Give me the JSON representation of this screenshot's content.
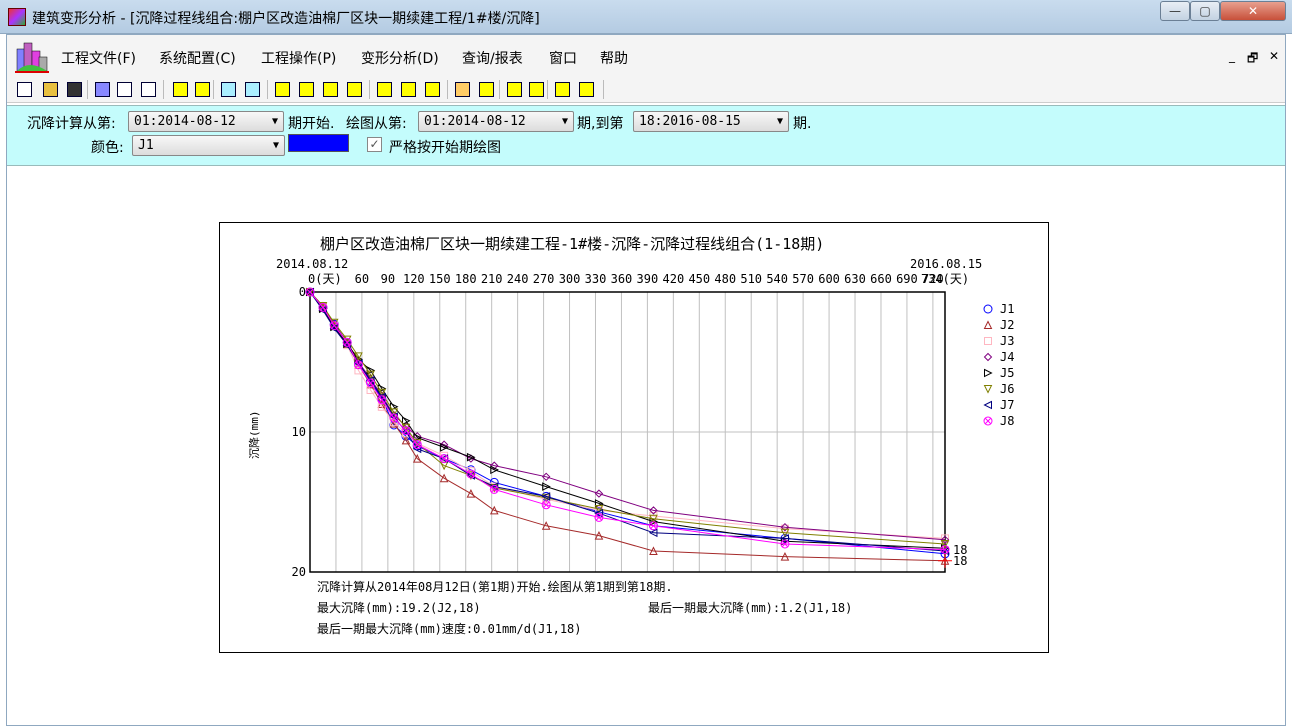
{
  "window": {
    "title": "建筑变形分析 - [沉降过程线组合:棚户区改造油棉厂区块一期续建工程/1#楼/沉降]",
    "controls": {
      "minimize": "—",
      "maximize": "▢",
      "close": "✕"
    }
  },
  "menu": {
    "items": [
      "工程文件(F)",
      "系统配置(C)",
      "工程操作(P)",
      "变形分析(D)",
      "查询/报表",
      "窗口",
      "帮助"
    ],
    "mdi": {
      "minimize": "_",
      "restore": "🗗",
      "close": "✕"
    }
  },
  "params": {
    "calc_from_label": "沉降计算从第:",
    "calc_from_value": "01:2014-08-12",
    "period_start_label": "期开始.",
    "plot_from_label": "绘图从第:",
    "plot_from_value": "01:2014-08-12",
    "to_label": "期,到第",
    "to_value": "18:2016-08-15",
    "end_label": "期.",
    "color_label": "颜色:",
    "color_point": "J1",
    "color_value": "#0000ff",
    "strict_label": "严格按开始期绘图",
    "strict_checked": true
  },
  "chart_data": {
    "type": "line",
    "title": "棚户区改造油棉厂区块一期续建工程-1#楼-沉降-沉降过程线组合(1-18期)",
    "start_date": "2014.08.12",
    "end_date": "2016.08.15",
    "ylabel": "沉降(mm)",
    "ylim": [
      0,
      20
    ],
    "xlim": [
      0,
      734
    ],
    "y_ticks": [
      "0",
      "10",
      "20"
    ],
    "x_tick_labels": [
      {
        "d": 0,
        "t": "0(天)"
      },
      {
        "d": 60,
        "t": "60"
      },
      {
        "d": 90,
        "t": "90"
      },
      {
        "d": 120,
        "t": "120"
      },
      {
        "d": 150,
        "t": "150"
      },
      {
        "d": 180,
        "t": "180"
      },
      {
        "d": 210,
        "t": "210"
      },
      {
        "d": 240,
        "t": "240"
      },
      {
        "d": 270,
        "t": "270"
      },
      {
        "d": 300,
        "t": "300"
      },
      {
        "d": 330,
        "t": "330"
      },
      {
        "d": 360,
        "t": "360"
      },
      {
        "d": 390,
        "t": "390"
      },
      {
        "d": 420,
        "t": "420"
      },
      {
        "d": 450,
        "t": "450"
      },
      {
        "d": 480,
        "t": "480"
      },
      {
        "d": 510,
        "t": "510"
      },
      {
        "d": 540,
        "t": "540"
      },
      {
        "d": 570,
        "t": "570"
      },
      {
        "d": 600,
        "t": "600"
      },
      {
        "d": 630,
        "t": "630"
      },
      {
        "d": 660,
        "t": "660"
      },
      {
        "d": 690,
        "t": "690"
      },
      {
        "d": 720,
        "t": "720"
      },
      {
        "d": 734,
        "t": "734(天)"
      }
    ],
    "grid": true,
    "legend": "right",
    "x": [
      0,
      15,
      28,
      43,
      56,
      70,
      83,
      97,
      111,
      124,
      155,
      186,
      213,
      273,
      334,
      397,
      549,
      734
    ],
    "series": [
      {
        "name": "J1",
        "color": "#0000ff",
        "marker": "circle",
        "values": [
          0,
          1.1,
          2.3,
          3.6,
          5.0,
          6.4,
          7.6,
          9.5,
          10.3,
          11.0,
          11.9,
          12.7,
          13.6,
          14.6,
          15.7,
          16.7,
          17.6,
          18.7
        ]
      },
      {
        "name": "J2",
        "color": "#a52a2a",
        "marker": "triangle-up",
        "values": [
          0,
          1.1,
          2.4,
          3.7,
          5.2,
          6.6,
          8.0,
          9.4,
          10.6,
          11.9,
          13.3,
          14.4,
          15.6,
          16.7,
          17.4,
          18.5,
          18.9,
          19.2
        ]
      },
      {
        "name": "J3",
        "color": "#ffb6c1",
        "marker": "square",
        "values": [
          0,
          1.0,
          2.4,
          3.8,
          5.6,
          7.0,
          8.2,
          9.3,
          10.1,
          10.8,
          11.7,
          12.8,
          13.9,
          14.8,
          15.6,
          16.0,
          16.9,
          17.6
        ]
      },
      {
        "name": "J4",
        "color": "#800080",
        "marker": "diamond",
        "values": [
          0,
          1.0,
          2.3,
          3.6,
          5.0,
          6.2,
          7.4,
          8.8,
          9.6,
          10.3,
          10.9,
          11.9,
          12.4,
          13.2,
          14.4,
          15.6,
          16.8,
          17.7
        ]
      },
      {
        "name": "J5",
        "color": "#000000",
        "marker": "triangle-right",
        "values": [
          0,
          1.2,
          2.5,
          3.7,
          4.8,
          5.6,
          6.9,
          8.2,
          9.2,
          10.4,
          11.1,
          11.8,
          12.7,
          13.9,
          15.1,
          16.4,
          17.8,
          18.3
        ]
      },
      {
        "name": "J6",
        "color": "#808000",
        "marker": "triangle-down",
        "values": [
          0,
          1.0,
          2.2,
          3.4,
          4.6,
          5.9,
          7.2,
          8.6,
          9.7,
          10.8,
          12.4,
          13.1,
          14.0,
          14.7,
          15.5,
          16.2,
          17.2,
          18.0
        ]
      },
      {
        "name": "J7",
        "color": "#000080",
        "marker": "triangle-left",
        "values": [
          0,
          1.3,
          2.6,
          3.8,
          5.1,
          6.3,
          7.5,
          8.9,
          10.0,
          11.2,
          11.9,
          13.1,
          13.9,
          14.6,
          15.8,
          17.2,
          17.6,
          18.5
        ]
      },
      {
        "name": "J8",
        "color": "#ff00ff",
        "marker": "circle-x",
        "values": [
          0,
          1.1,
          2.4,
          3.6,
          5.2,
          6.5,
          7.7,
          9.0,
          9.9,
          10.9,
          11.9,
          13.0,
          14.1,
          15.2,
          16.1,
          16.7,
          18.0,
          18.4
        ]
      }
    ],
    "end_labels": [
      "18",
      "18"
    ],
    "notes": {
      "line1": "沉降计算从2014年08月12日(第1期)开始.绘图从第1期到第18期.",
      "max_settle": "最大沉降(mm):19.2(J2,18)",
      "last_max": "最后一期最大沉降(mm):1.2(J1,18)",
      "last_rate": "最后一期最大沉降(mm)速度:0.01mm/d(J1,18)"
    }
  }
}
